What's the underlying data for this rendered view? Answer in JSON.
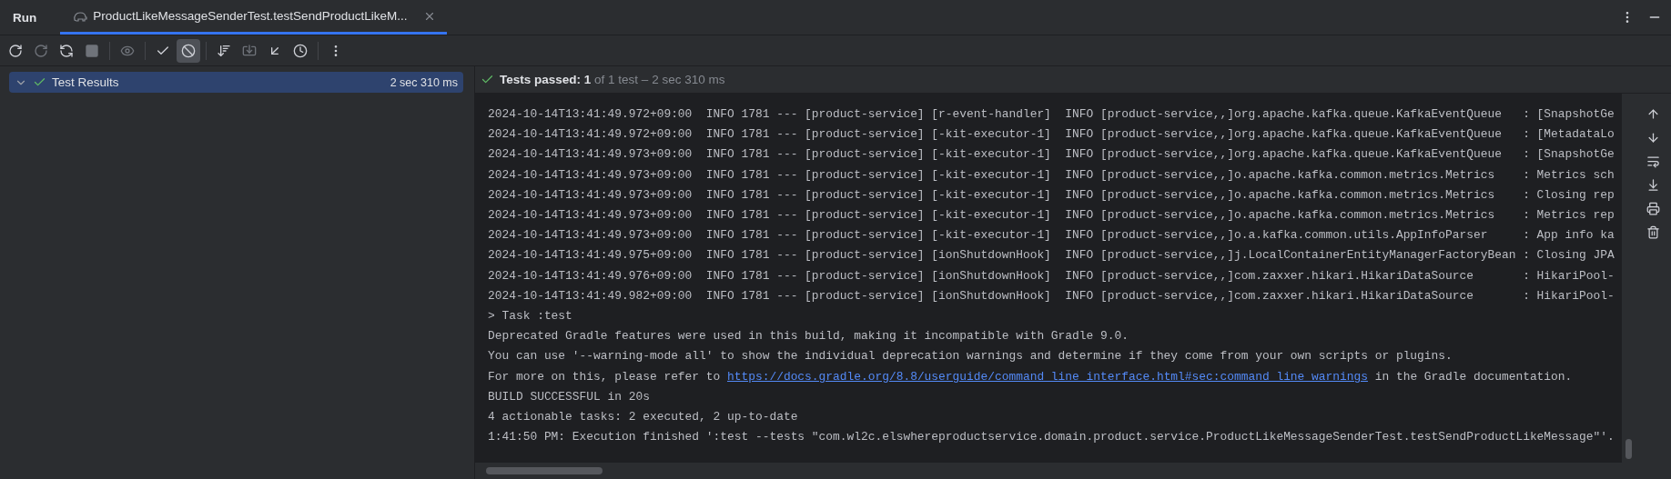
{
  "topbar": {
    "title": "Run",
    "tab": {
      "label": "ProductLikeMessageSenderTest.testSendProductLikeM...",
      "selected": true
    }
  },
  "toolbar": {
    "groups": [
      [
        {
          "kind": "rerun",
          "disabled": false,
          "selected": false
        },
        {
          "kind": "rerunfailed",
          "disabled": true,
          "selected": false
        },
        {
          "kind": "toggle",
          "disabled": false,
          "selected": false
        },
        {
          "kind": "stop",
          "disabled": true,
          "selected": false
        }
      ],
      [
        {
          "kind": "eye",
          "disabled": true,
          "selected": false
        }
      ],
      [
        {
          "kind": "check",
          "disabled": false,
          "selected": false
        },
        {
          "kind": "ban",
          "disabled": false,
          "selected": true
        }
      ],
      [
        {
          "kind": "sort",
          "disabled": false,
          "selected": false
        },
        {
          "kind": "import",
          "disabled": true,
          "selected": false
        },
        {
          "kind": "collapse",
          "disabled": false,
          "selected": false
        },
        {
          "kind": "clock",
          "disabled": false,
          "selected": false
        }
      ],
      [
        {
          "kind": "more",
          "disabled": false,
          "selected": false
        }
      ]
    ]
  },
  "tree": {
    "items": [
      {
        "label": "Test Results",
        "time": "2 sec 310 ms",
        "expanded": true,
        "selected": true,
        "passed": true
      }
    ]
  },
  "console": {
    "status": {
      "passed": true,
      "label": "Tests passed:",
      "count": "1",
      "detail": "of 1 test – 2 sec 310 ms"
    },
    "lines": [
      {
        "kind": "log",
        "text": "2024-10-14T13:41:49.972+09:00  INFO 1781 --- [product-service] [r-event-handler]  INFO [product-service,,]org.apache.kafka.queue.KafkaEventQueue   : [SnapshotGe"
      },
      {
        "kind": "log",
        "text": "2024-10-14T13:41:49.972+09:00  INFO 1781 --- [product-service] [-kit-executor-1]  INFO [product-service,,]org.apache.kafka.queue.KafkaEventQueue   : [MetadataLo"
      },
      {
        "kind": "log",
        "text": "2024-10-14T13:41:49.973+09:00  INFO 1781 --- [product-service] [-kit-executor-1]  INFO [product-service,,]org.apache.kafka.queue.KafkaEventQueue   : [SnapshotGe"
      },
      {
        "kind": "log",
        "text": "2024-10-14T13:41:49.973+09:00  INFO 1781 --- [product-service] [-kit-executor-1]  INFO [product-service,,]o.apache.kafka.common.metrics.Metrics    : Metrics sch"
      },
      {
        "kind": "log",
        "text": "2024-10-14T13:41:49.973+09:00  INFO 1781 --- [product-service] [-kit-executor-1]  INFO [product-service,,]o.apache.kafka.common.metrics.Metrics    : Closing rep"
      },
      {
        "kind": "log",
        "text": "2024-10-14T13:41:49.973+09:00  INFO 1781 --- [product-service] [-kit-executor-1]  INFO [product-service,,]o.apache.kafka.common.metrics.Metrics    : Metrics rep"
      },
      {
        "kind": "log",
        "text": "2024-10-14T13:41:49.973+09:00  INFO 1781 --- [product-service] [-kit-executor-1]  INFO [product-service,,]o.a.kafka.common.utils.AppInfoParser     : App info ka"
      },
      {
        "kind": "log",
        "text": "2024-10-14T13:41:49.975+09:00  INFO 1781 --- [product-service] [ionShutdownHook]  INFO [product-service,,]j.LocalContainerEntityManagerFactoryBean : Closing JPA"
      },
      {
        "kind": "log",
        "text": "2024-10-14T13:41:49.976+09:00  INFO 1781 --- [product-service] [ionShutdownHook]  INFO [product-service,,]com.zaxxer.hikari.HikariDataSource       : HikariPool-"
      },
      {
        "kind": "log",
        "text": "2024-10-14T13:41:49.982+09:00  INFO 1781 --- [product-service] [ionShutdownHook]  INFO [product-service,,]com.zaxxer.hikari.HikariDataSource       : HikariPool-"
      },
      {
        "kind": "text",
        "text": "> Task :test"
      },
      {
        "kind": "text",
        "text": "Deprecated Gradle features were used in this build, making it incompatible with Gradle 9.0."
      },
      {
        "kind": "text",
        "text": "You can use '--warning-mode all' to show the individual deprecation warnings and determine if they come from your own scripts or plugins."
      },
      {
        "kind": "link",
        "prefix": "For more on this, please refer to ",
        "link": "https://docs.gradle.org/8.8/userguide/command_line_interface.html#sec:command_line_warnings",
        "suffix": " in the Gradle documentation."
      },
      {
        "kind": "text",
        "text": "BUILD SUCCESSFUL in 20s"
      },
      {
        "kind": "text",
        "text": "4 actionable tasks: 2 executed, 2 up-to-date"
      },
      {
        "kind": "text",
        "text": "1:41:50 PM: Execution finished ':test --tests \"com.wl2c.elswhereproductservice.domain.product.service.ProductLikeMessageSenderTest.testSendProductLikeMessage\"'."
      }
    ]
  },
  "gutter": [
    {
      "kind": "up"
    },
    {
      "kind": "down"
    },
    {
      "kind": "wrap"
    },
    {
      "kind": "scrollend"
    },
    {
      "kind": "print"
    },
    {
      "kind": "trash"
    }
  ]
}
